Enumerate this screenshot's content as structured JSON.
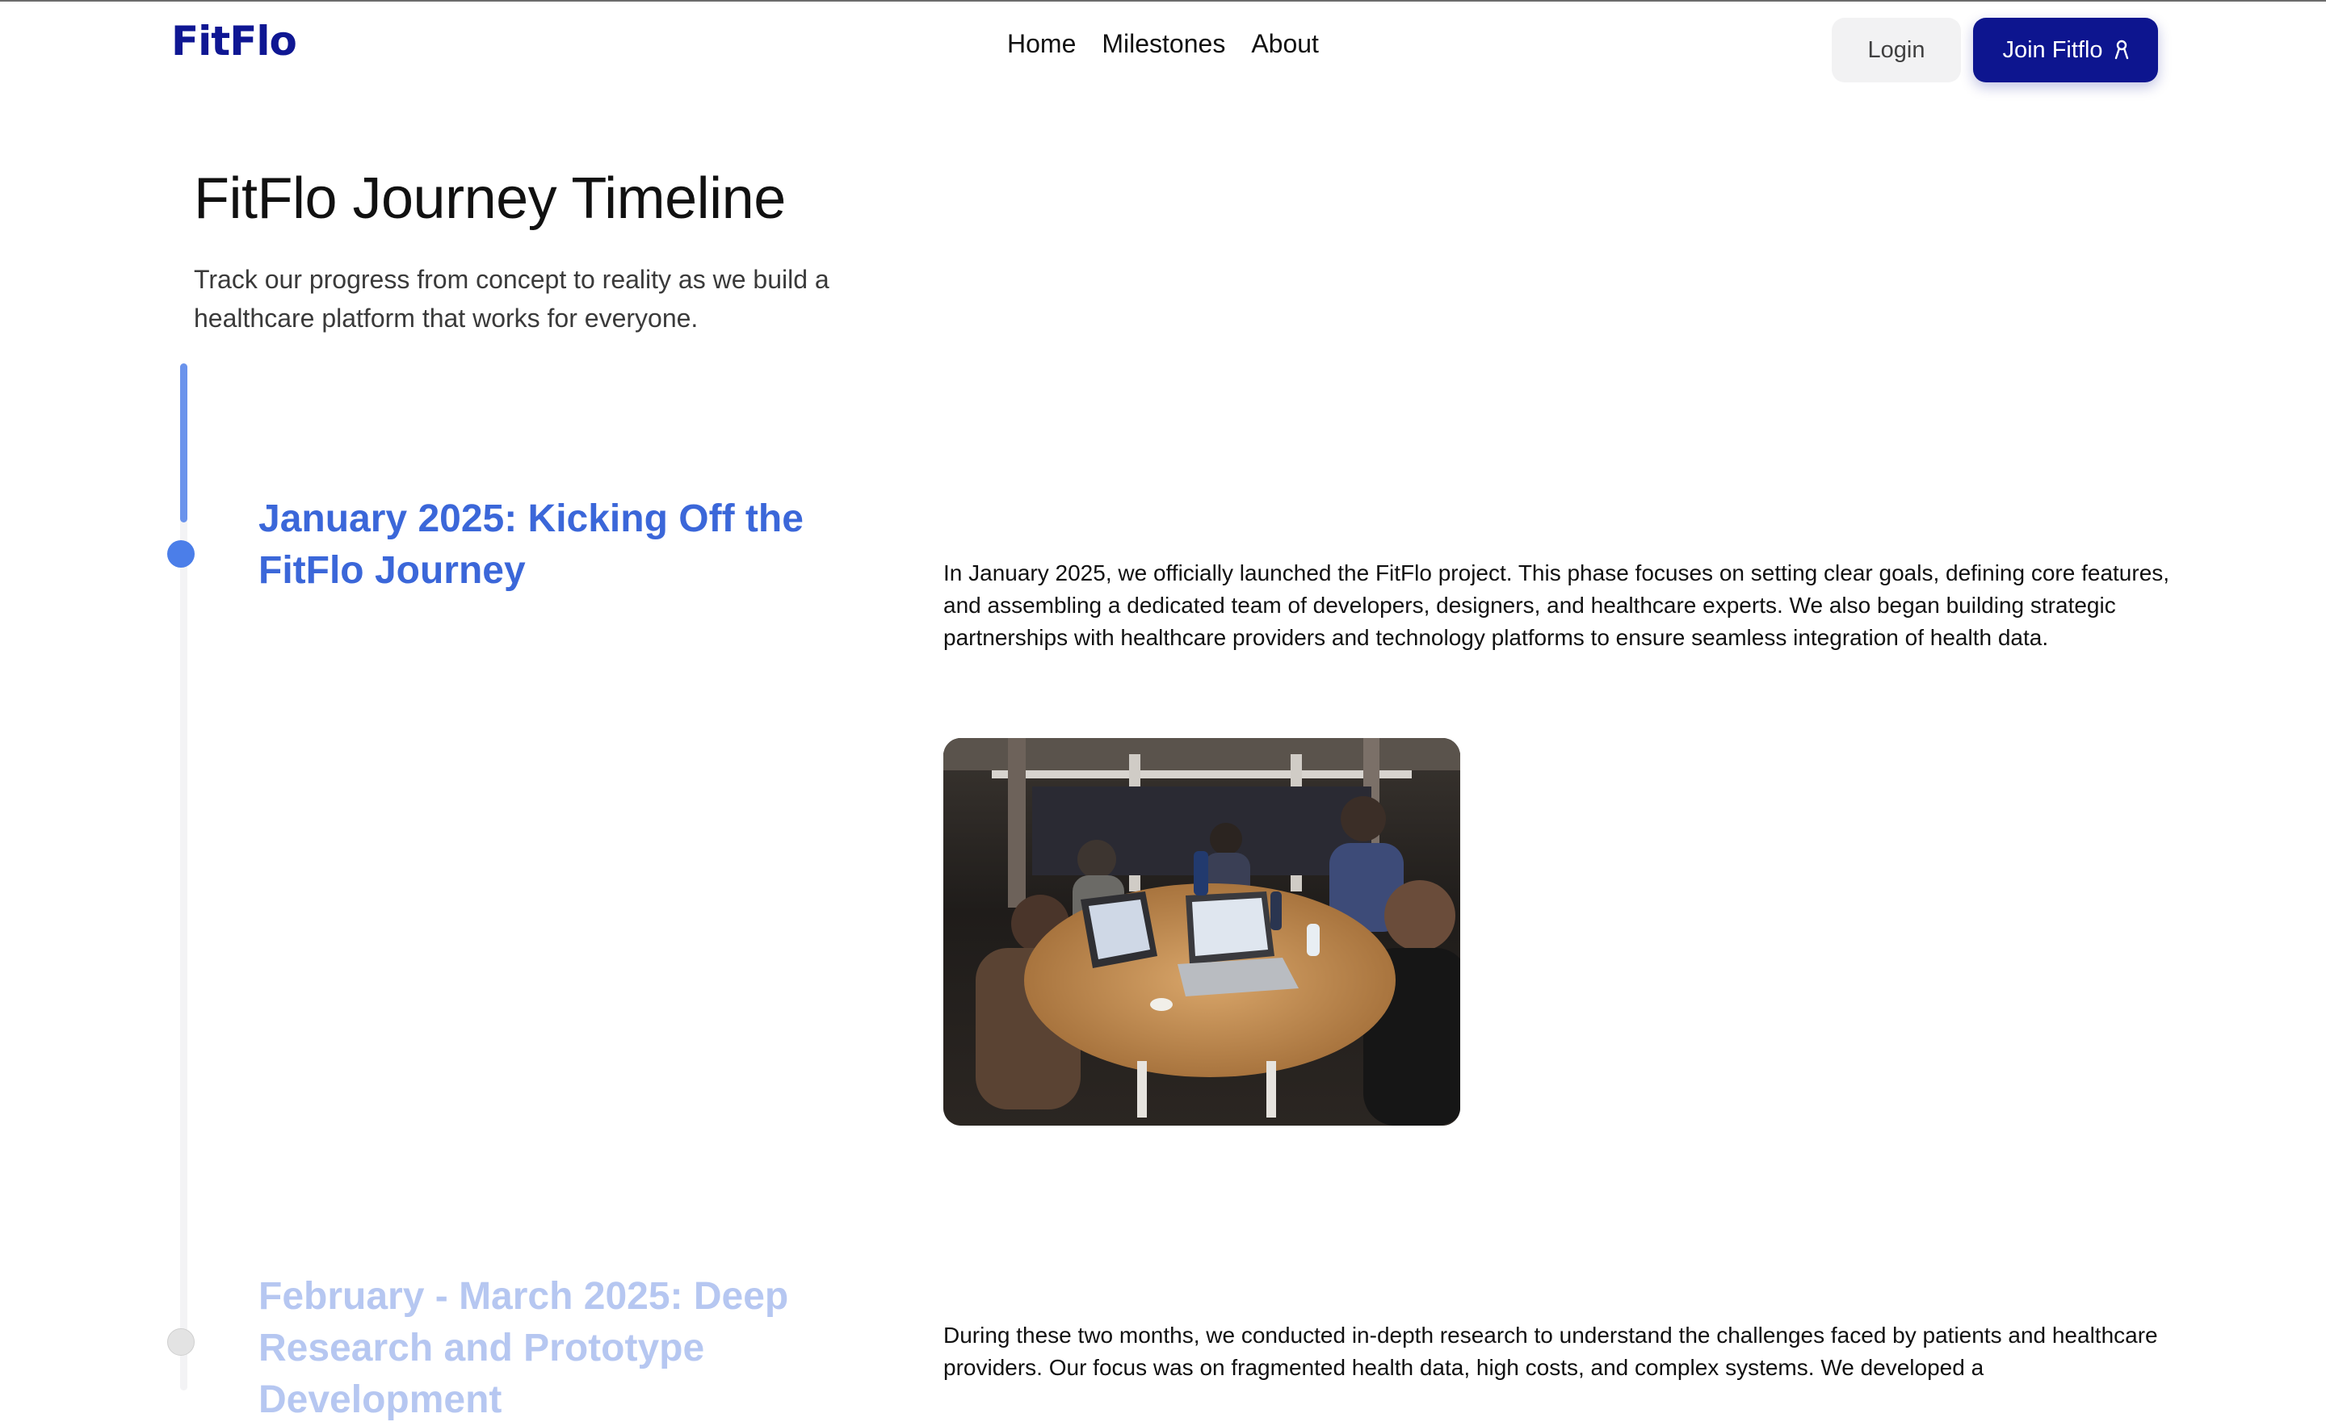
{
  "header": {
    "logo_text": "FitFlo",
    "logo_icon": "fitflo-logo",
    "nav": [
      {
        "label": "Home"
      },
      {
        "label": "Milestones"
      },
      {
        "label": "About"
      }
    ],
    "login_label": "Login",
    "join_label": "Join Fitflo",
    "join_icon": "ribbon-icon"
  },
  "hero": {
    "title": "FitFlo Journey Timeline",
    "subtitle": "Track our progress from concept to reality as we build a healthcare platform that works for everyone."
  },
  "milestones": [
    {
      "title": "January 2025: Kicking Off the FitFlo Journey",
      "description": "In January 2025, we officially launched the FitFlo project. This phase focuses on setting clear goals, defining core features, and assembling a dedicated team of developers, designers, and healthcare experts. We also began building strategic partnerships with healthcare providers and technology platforms to ensure seamless integration of health data.",
      "status": "active"
    },
    {
      "title": "February - March 2025: Deep Research and Prototype Development",
      "description": "During these two months, we conducted in-depth research to understand the challenges faced by patients and healthcare providers. Our focus was on fragmented health data, high costs, and complex systems. We developed a",
      "status": "upcoming"
    }
  ],
  "colors": {
    "brand": "#0d158f",
    "accent": "#4b7ee9",
    "title_active": "#3b67d9",
    "title_inactive": "#b6c7f1"
  }
}
